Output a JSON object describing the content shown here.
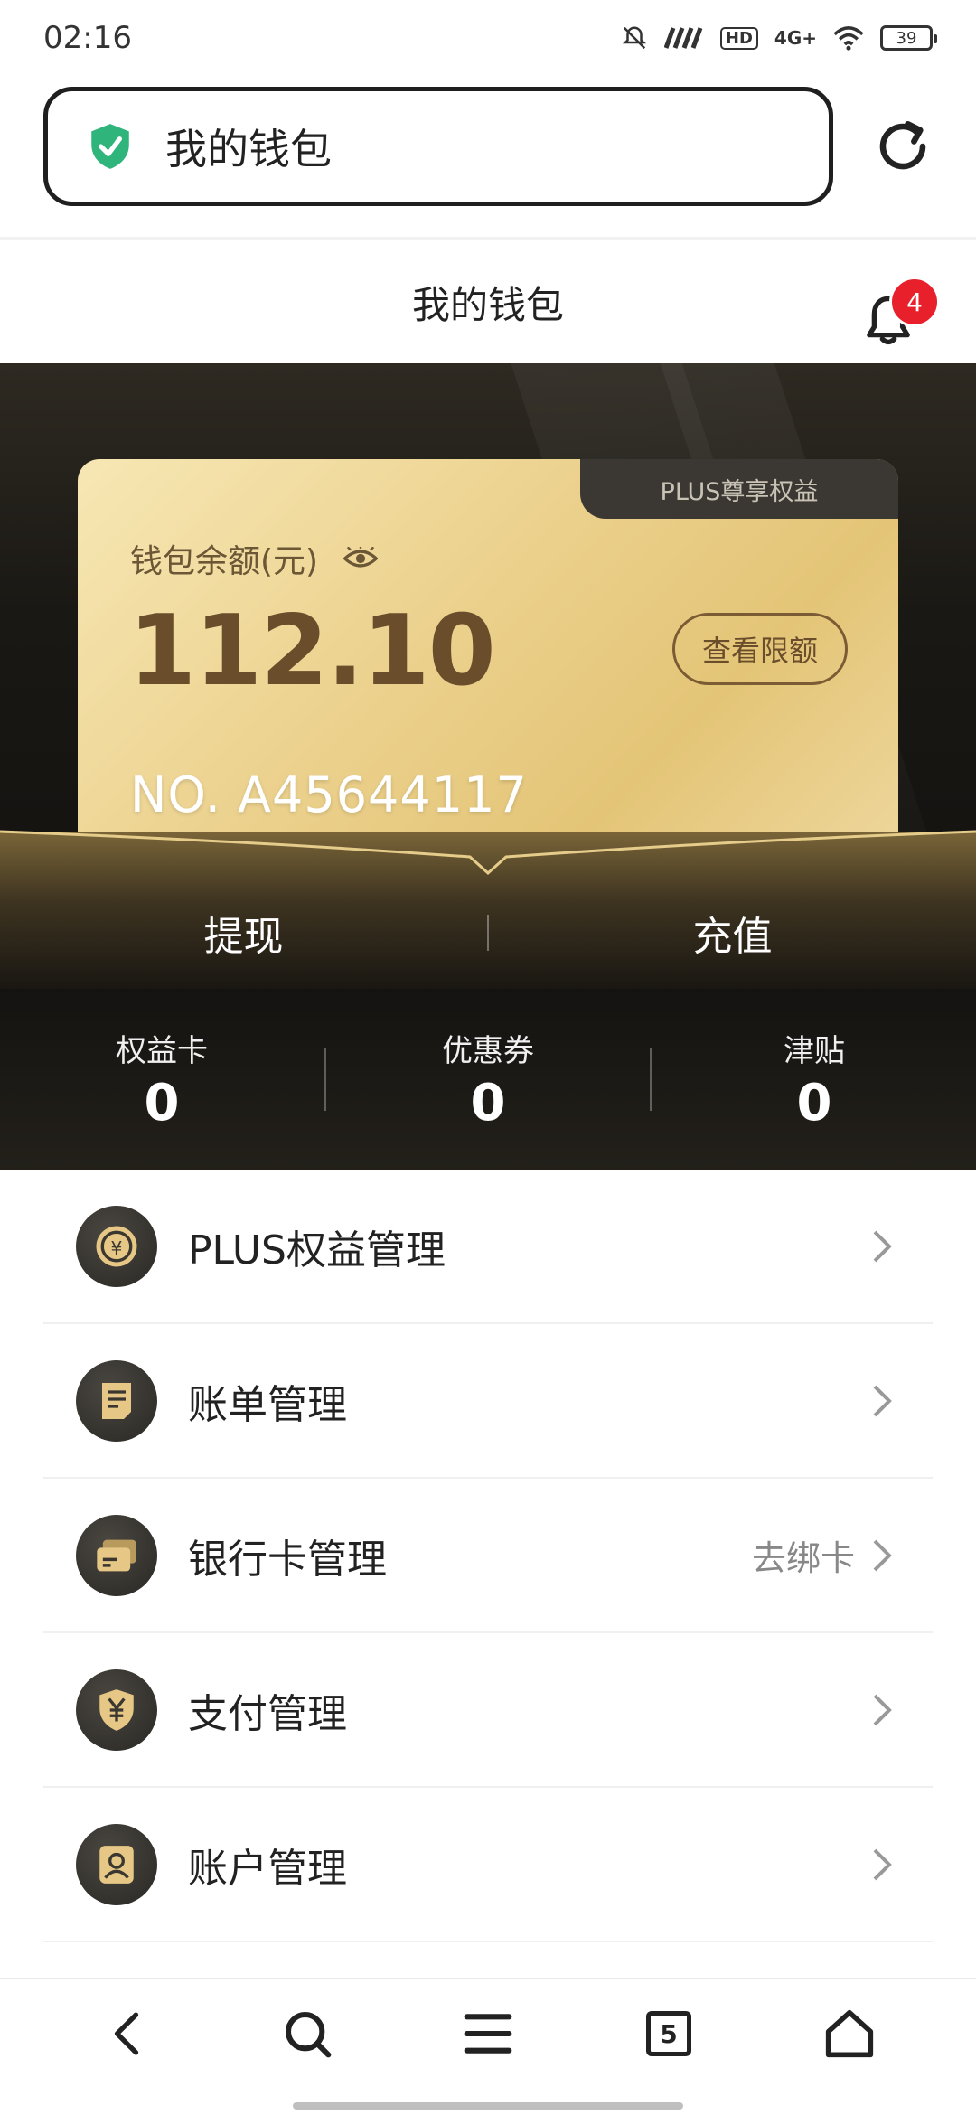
{
  "status_bar": {
    "time": "02:16",
    "network": "4G+",
    "hd": "HD",
    "battery": "39"
  },
  "url_bar": {
    "text": "我的钱包",
    "shield_icon": "shield-check-icon",
    "reload_icon": "reload-icon"
  },
  "header": {
    "title": "我的钱包",
    "notification_count": "4"
  },
  "card": {
    "tab_label": "PLUS尊享权益",
    "balance_label": "钱包余额(元)",
    "balance": "112.10",
    "limit_button": "查看限额",
    "card_number": "NO. A45644117"
  },
  "actions": {
    "withdraw": "提现",
    "recharge": "充值"
  },
  "stats": [
    {
      "label": "权益卡",
      "value": "0"
    },
    {
      "label": "优惠券",
      "value": "0"
    },
    {
      "label": "津贴",
      "value": "0"
    }
  ],
  "menu": [
    {
      "label": "PLUS权益管理",
      "extra": "",
      "icon": "coin-icon"
    },
    {
      "label": "账单管理",
      "extra": "",
      "icon": "bill-icon"
    },
    {
      "label": "银行卡管理",
      "extra": "去绑卡",
      "icon": "bank-card-icon"
    },
    {
      "label": "支付管理",
      "extra": "",
      "icon": "yuan-shield-icon"
    },
    {
      "label": "账户管理",
      "extra": "",
      "icon": "user-profile-icon"
    }
  ],
  "bottom_nav": {
    "tab_count": "5"
  },
  "colors": {
    "accent_gold": "#e4c577",
    "dark_bg": "#1a1814",
    "badge_red": "#e8202c",
    "secure_green": "#2fb47b"
  }
}
